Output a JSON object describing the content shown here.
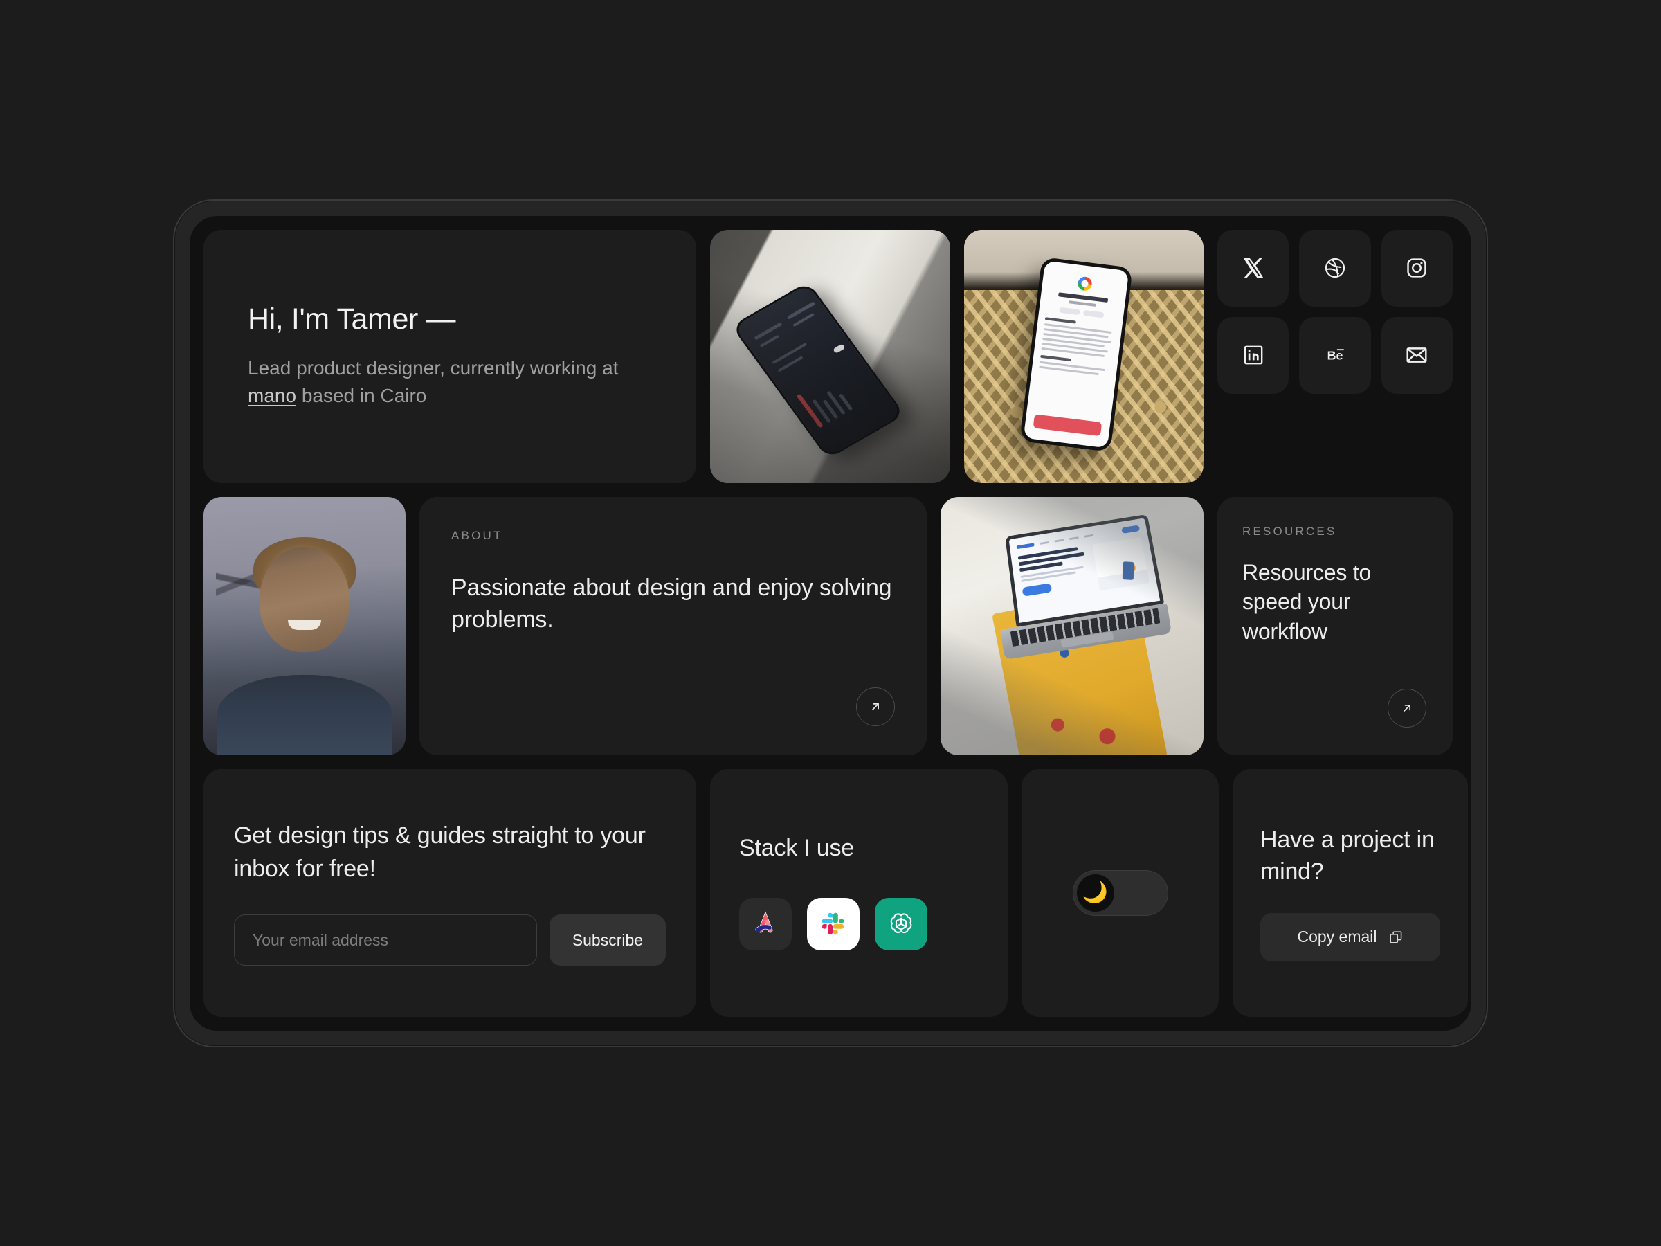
{
  "hero": {
    "title": "Hi, I'm Tamer —",
    "sub_before": "Lead product designer, currently working at ",
    "sub_link": "mano",
    "sub_after": " based in Cairo"
  },
  "projects": [
    {
      "name": "phone-dark-ui-project",
      "alt": "Dark mobile app UI on concrete ledge"
    },
    {
      "name": "phone-job-listing-project",
      "alt": "Product Designer job listing app on rattan chair",
      "screen_title": "Product Designer",
      "screen_cta": "Apply Now"
    },
    {
      "name": "laptop-landing-page-project",
      "alt": "MacBook on paint-splattered stool showing landing page",
      "screen_headline": "Engage More Customers and Boost Your Sales"
    }
  ],
  "portrait": {
    "alt": "Portrait of Tamer smiling outdoors at dusk"
  },
  "about": {
    "eyebrow": "ABOUT",
    "title": "Passionate about design and enjoy solving problems.",
    "arrow_icon": "arrow-up-right-icon"
  },
  "socials": [
    {
      "name": "x-twitter",
      "label": "X"
    },
    {
      "name": "dribbble",
      "label": "Dribbble"
    },
    {
      "name": "instagram",
      "label": "Instagram"
    },
    {
      "name": "linkedin",
      "label": "LinkedIn"
    },
    {
      "name": "behance",
      "label": "Behance"
    },
    {
      "name": "email",
      "label": "Email"
    }
  ],
  "resources": {
    "eyebrow": "RESOURCES",
    "title": "Resources to speed your workflow",
    "arrow_icon": "arrow-up-right-icon"
  },
  "newsletter": {
    "title": "Get design tips & guides straight to your inbox for free!",
    "input_placeholder": "Your email address",
    "input_value": "",
    "button_label": "Subscribe"
  },
  "stack": {
    "title": "Stack I use",
    "items": [
      {
        "name": "arc-browser",
        "label": "Arc"
      },
      {
        "name": "slack",
        "label": "Slack"
      },
      {
        "name": "openai-chatgpt",
        "label": "ChatGPT"
      }
    ]
  },
  "theme_toggle": {
    "state": "dark",
    "knob_icon": "crescent-moon-icon",
    "knob_glyph": "🌙"
  },
  "contact": {
    "title": "Have a project in mind?",
    "button_label": "Copy email",
    "button_icon": "copy-icon"
  },
  "colors": {
    "page_bg": "#1c1c1c",
    "frame_bg": "#252525",
    "screen_bg": "#111111",
    "card_bg": "#1d1d1d",
    "text_primary": "#ededed",
    "text_muted": "#a0a0a0",
    "eyebrow": "#8a8a8a",
    "button_bg": "#333333",
    "slack_bg": "#ffffff",
    "openai_green": "#10a37f",
    "apply_red": "#e2515b"
  }
}
